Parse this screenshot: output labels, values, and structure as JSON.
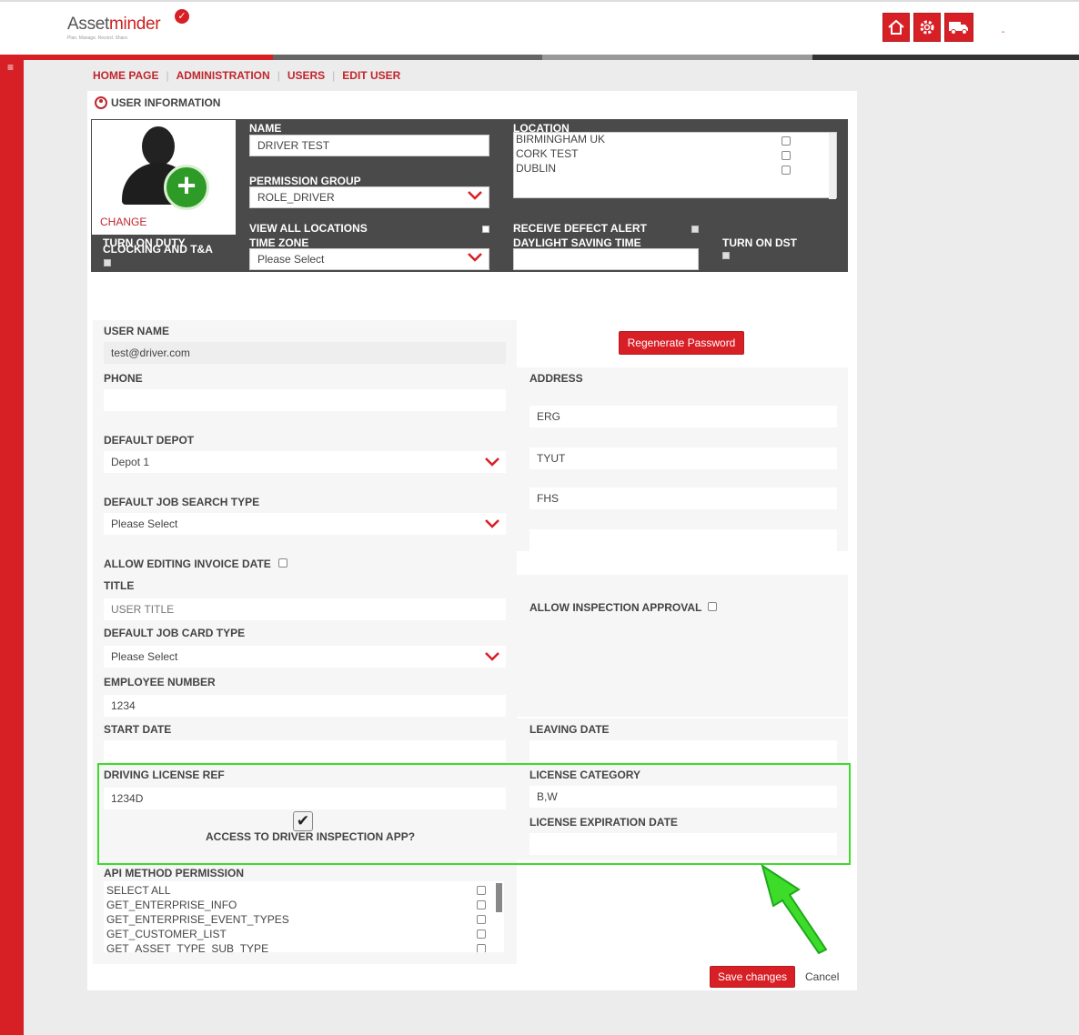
{
  "header": {
    "logo": "Assetminder",
    "logo_tagline": "Plan. Manage. Record. Share.",
    "icons": [
      "home-icon",
      "gear-icon",
      "truck-icon"
    ],
    "dash": "-"
  },
  "breadcrumb": [
    "HOME PAGE",
    "ADMINISTRATION",
    "USERS",
    "EDIT USER"
  ],
  "panel": {
    "title": "USER INFORMATION"
  },
  "photo": {
    "change_label": "CHANGE"
  },
  "top_form": {
    "name_label": "NAME",
    "name_value": "DRIVER TEST",
    "permission_label": "PERMISSION GROUP",
    "permission_value": "ROLE_DRIVER",
    "location_label": "LOCATION",
    "locations": [
      "BIRMINGHAM UK",
      "CORK TEST",
      "DUBLIN"
    ],
    "view_all_label": "VIEW ALL LOCATIONS",
    "defect_label": "RECEIVE DEFECT ALERT",
    "turn_on_duty_label": "TURN ON DUTY",
    "clocking_label": "CLOCKING AND T&A",
    "timezone_label": "TIME ZONE",
    "timezone_value": "Please Select",
    "dst_time_label": "DAYLIGHT SAVING TIME",
    "dst_label": "TURN ON DST"
  },
  "form": {
    "username_label": "USER NAME",
    "username_value": "test@driver.com",
    "regenerate_button": "Regenerate Password",
    "phone_label": "PHONE",
    "address_label": "ADDRESS",
    "address_lines": [
      "ERG",
      "TYUT",
      "FHS",
      ""
    ],
    "default_depot_label": "DEFAULT DEPOT",
    "default_depot_value": "Depot 1",
    "job_search_label": "DEFAULT JOB SEARCH TYPE",
    "job_search_value": "Please Select",
    "invoice_date_label": "ALLOW EDITING INVOICE DATE",
    "title_label": "TITLE",
    "title_placeholder": "USER TITLE",
    "inspection_approval_label": "ALLOW INSPECTION APPROVAL",
    "job_card_label": "DEFAULT JOB CARD TYPE",
    "job_card_value": "Please Select",
    "employee_number_label": "EMPLOYEE NUMBER",
    "employee_number_value": "1234",
    "start_date_label": "START DATE",
    "leaving_date_label": "LEAVING DATE",
    "driving_license_label": "DRIVING LICENSE REF",
    "driving_license_value": "1234D",
    "license_category_label": "LICENSE CATEGORY",
    "license_category_value": "B,W",
    "driver_app_label": "ACCESS TO DRIVER INSPECTION APP?",
    "license_expiry_label": "LICENSE EXPIRATION DATE",
    "api_label": "API METHOD PERMISSION",
    "api_items": [
      "SELECT ALL",
      "GET_ENTERPRISE_INFO",
      "GET_ENTERPRISE_EVENT_TYPES",
      "GET_CUSTOMER_LIST",
      "GET_ASSET_TYPE_SUB_TYPE"
    ]
  },
  "footer": {
    "save_button": "Save changes",
    "cancel_link": "Cancel"
  },
  "colors": {
    "brand_red": "#d71f26",
    "highlight_green": "#3ddc2a",
    "dark_panel": "#4a4a4a"
  }
}
